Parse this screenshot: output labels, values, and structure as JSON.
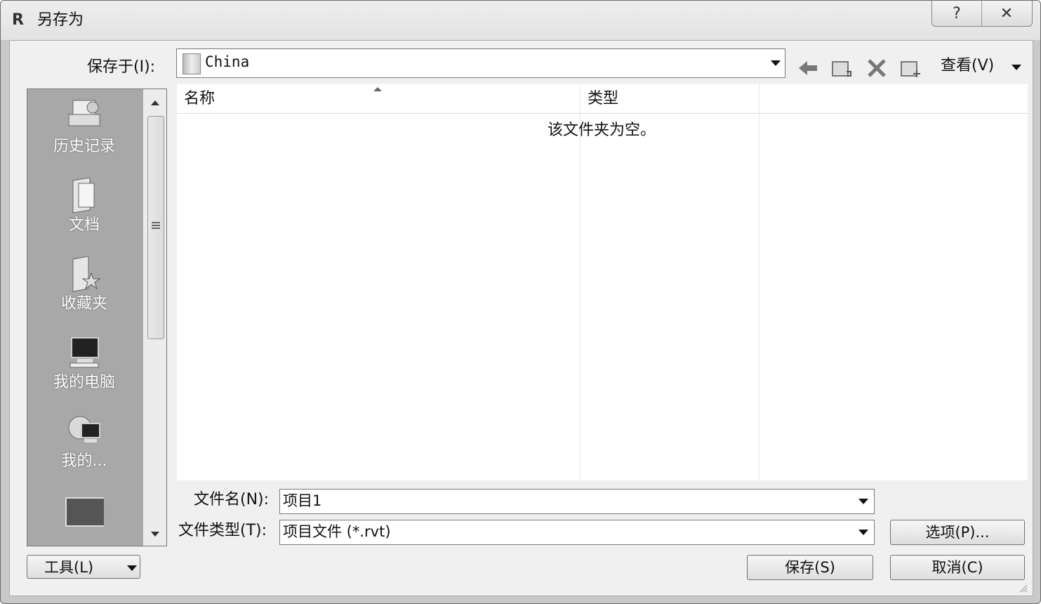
{
  "dialog": {
    "title": "另存为",
    "help_symbol": "?",
    "close_symbol": "✕"
  },
  "save_in": {
    "label": "保存于(I):",
    "value": "China"
  },
  "toolbar": {
    "view_label": "查看(V)"
  },
  "places": [
    {
      "label": "历史记录",
      "icon": "history-icon"
    },
    {
      "label": "文档",
      "icon": "documents-icon"
    },
    {
      "label": "收藏夹",
      "icon": "favorites-icon"
    },
    {
      "label": "我的电脑",
      "icon": "computer-icon"
    },
    {
      "label": "我的...",
      "icon": "network-icon"
    }
  ],
  "file_list": {
    "columns": [
      "名称",
      "类型"
    ],
    "empty_message": "该文件夹为空。"
  },
  "file_name": {
    "label": "文件名(N):",
    "value": "项目1"
  },
  "file_type": {
    "label": "文件类型(T):",
    "value": "项目文件 (*.rvt)"
  },
  "buttons": {
    "options": "选项(P)...",
    "tools": "工具(L)",
    "save": "保存(S)",
    "cancel": "取消(C)"
  }
}
